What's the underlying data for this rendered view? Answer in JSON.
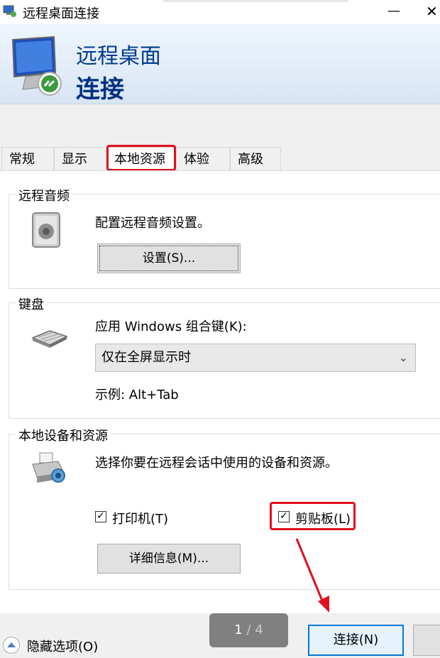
{
  "window": {
    "title": "远程桌面连接",
    "minimize_glyph": "—",
    "close_glyph": "✕"
  },
  "banner": {
    "line1": "远程桌面",
    "line2": "连接"
  },
  "tabs": [
    {
      "label": "常规"
    },
    {
      "label": "显示"
    },
    {
      "label": "本地资源",
      "active": true,
      "highlighted": true
    },
    {
      "label": "体验"
    },
    {
      "label": "高级"
    }
  ],
  "audio": {
    "legend": "远程音频",
    "description": "配置远程音频设置。",
    "settings_button": "设置(S)..."
  },
  "keyboard": {
    "legend": "键盘",
    "apply_label": "应用 Windows 组合键(K):",
    "selected_option": "仅在全屏显示时",
    "example": "示例: Alt+Tab"
  },
  "local_devices": {
    "legend": "本地设备和资源",
    "description": "选择你要在远程会话中使用的设备和资源。",
    "printer": {
      "label": "打印机(T)",
      "checked": true
    },
    "clipboard": {
      "label": "剪贴板(L)",
      "checked": true,
      "highlighted": true
    },
    "details_button": "详细信息(M)..."
  },
  "footer": {
    "hide_options": "隐藏选项(O)",
    "connect_button": "连接(N)",
    "pager_current": "1",
    "pager_total": " / 4"
  },
  "colors": {
    "highlight": "#e0101e",
    "banner_text": "#003c8f",
    "connect_border": "#0078d7"
  }
}
